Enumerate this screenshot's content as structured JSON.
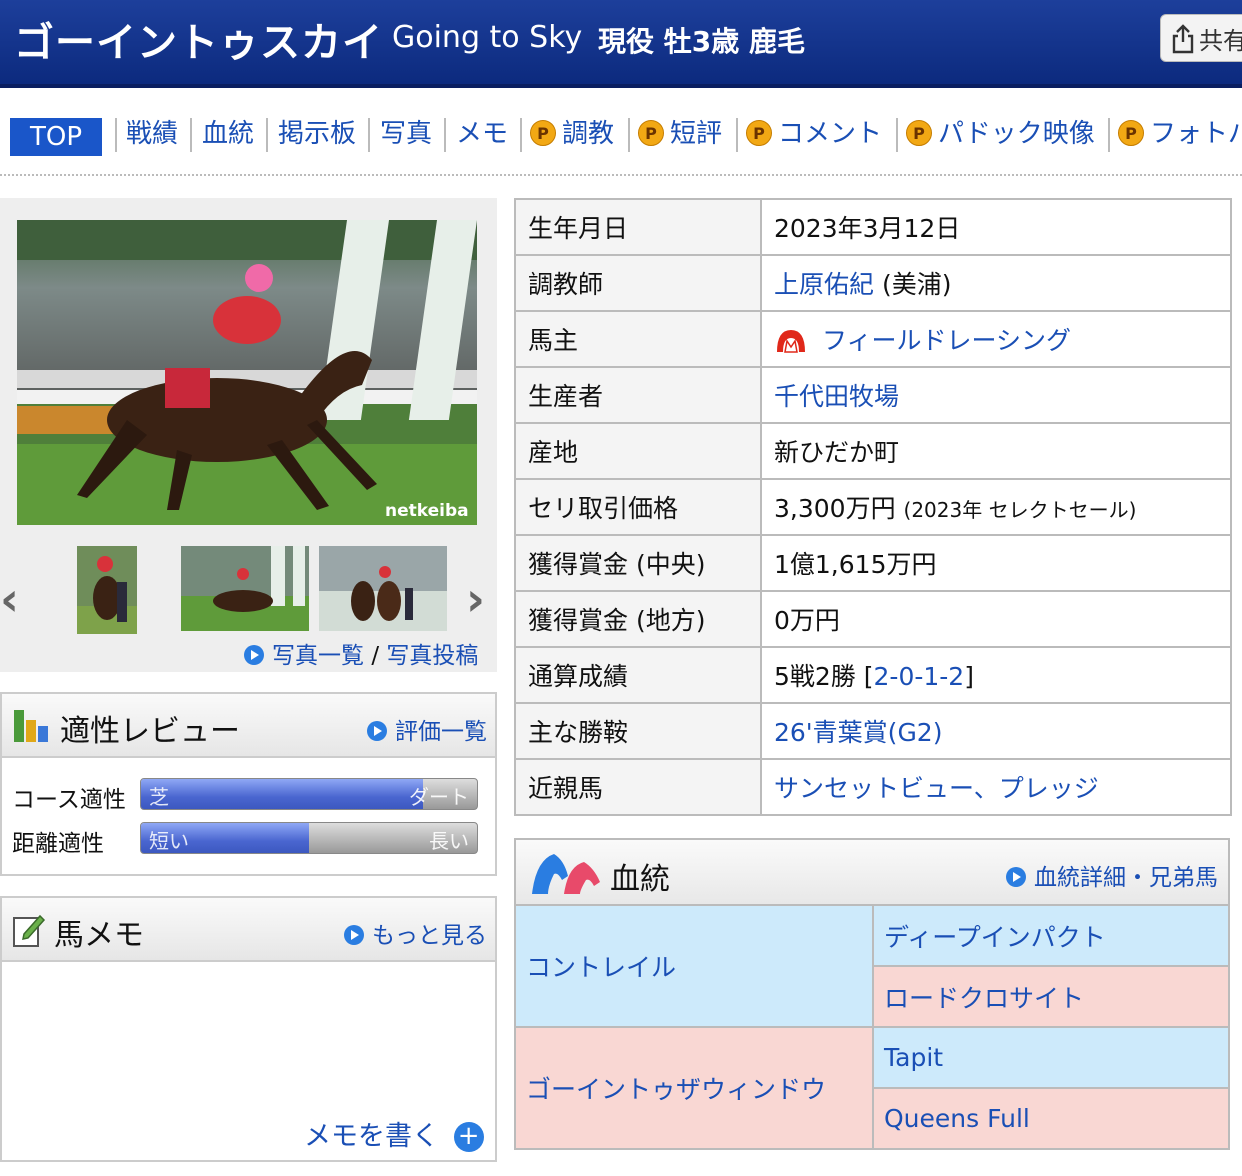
{
  "header": {
    "name_ja": "ゴーイントゥスカイ",
    "name_en": "Going to Sky",
    "info": "現役 牡3歳 鹿毛",
    "share_label": "共有"
  },
  "tabs": [
    {
      "label": "TOP",
      "premium": false,
      "active": true
    },
    {
      "label": "戦績",
      "premium": false
    },
    {
      "label": "血統",
      "premium": false
    },
    {
      "label": "掲示板",
      "premium": false
    },
    {
      "label": "写真",
      "premium": false
    },
    {
      "label": "メモ",
      "premium": false
    },
    {
      "label": "調教",
      "premium": true
    },
    {
      "label": "短評",
      "premium": true
    },
    {
      "label": "コメント",
      "premium": true
    },
    {
      "label": "パドック映像",
      "premium": true
    },
    {
      "label": "フォトパ",
      "premium": true
    }
  ],
  "premium_badge": "P",
  "photo": {
    "watermark": "netkeiba",
    "list_link": "写真一覧",
    "link_separator": "/",
    "post_link": "写真投稿"
  },
  "aptitude": {
    "title": "適性レビュー",
    "link": "評価一覧",
    "course": {
      "label": "コース適性",
      "left": "芝",
      "right": "ダート",
      "value_pct": 84
    },
    "distance": {
      "label": "距離適性",
      "left": "短い",
      "right": "長い",
      "value_pct": 50
    }
  },
  "memo": {
    "title": "馬メモ",
    "link": "もっと見る",
    "write": "メモを書く"
  },
  "profile": {
    "birth": {
      "key": "生年月日",
      "value": "2023年3月12日"
    },
    "trainer": {
      "key": "調教師",
      "name": "上原佑紀",
      "suffix": "(美浦)"
    },
    "owner": {
      "key": "馬主",
      "value": "フィールドレーシング"
    },
    "breeder": {
      "key": "生産者",
      "value": "千代田牧場"
    },
    "origin": {
      "key": "産地",
      "value": "新ひだか町"
    },
    "auction": {
      "key": "セリ取引価格",
      "value": "3,300万円",
      "note": "(2023年 セレクトセール)"
    },
    "prize_central": {
      "key": "獲得賞金 (中央)",
      "value": "1億1,615万円"
    },
    "prize_local": {
      "key": "獲得賞金 (地方)",
      "value": "0万円"
    },
    "record": {
      "key": "通算成績",
      "value": "5戦2勝",
      "open": "[",
      "link": "2-0-1-2",
      "close": "]"
    },
    "wins": {
      "key": "主な勝鞍",
      "value": "26'青葉賞(G2)"
    },
    "relatives": {
      "key": "近親馬",
      "value": "サンセットビュー、プレッジ"
    }
  },
  "pedigree": {
    "title": "血統",
    "link": "血統詳細・兄弟馬",
    "sire": "コントレイル",
    "sire_sire": "ディープインパクト",
    "sire_dam": "ロードクロサイト",
    "dam": "ゴーイントゥザウィンドウ",
    "dam_sire": "Tapit",
    "dam_dam": "Queens Full"
  },
  "colors": {
    "header_bg": "#1d3f9b",
    "link": "#1a4fb5",
    "tab_active": "#1a56c9",
    "male_bg": "#cdeafb",
    "female_bg": "#f9d7d3",
    "premium_badge": "#f2a814"
  }
}
